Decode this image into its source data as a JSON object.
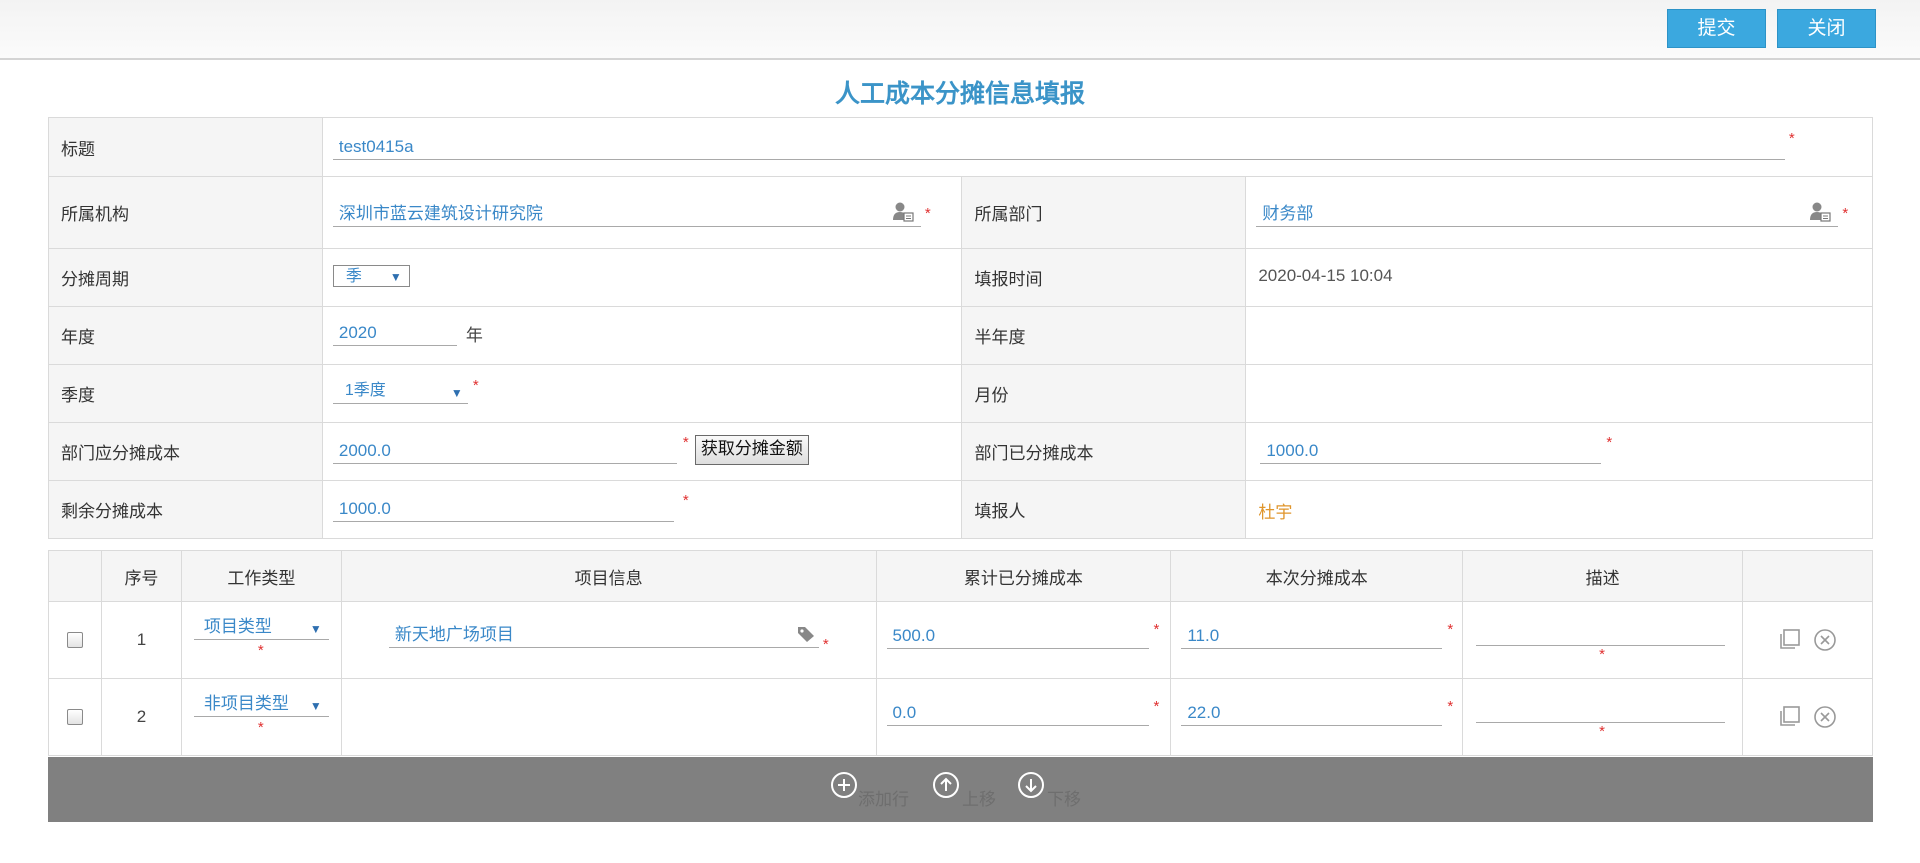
{
  "toolbar": {
    "submit_label": "提交",
    "close_label": "关闭"
  },
  "page_title": "人工成本分摊信息填报",
  "form": {
    "title": {
      "label": "标题",
      "value": "test0415a"
    },
    "org": {
      "label": "所属机构",
      "value": "深圳市蓝云建筑设计研究院"
    },
    "dept": {
      "label": "所属部门",
      "value": "财务部"
    },
    "period": {
      "label": "分摊周期",
      "value": "季"
    },
    "fill_time": {
      "label": "填报时间",
      "value": "2020-04-15 10:04"
    },
    "year": {
      "label": "年度",
      "value": "2020",
      "unit": "年"
    },
    "half_year": {
      "label": "半年度"
    },
    "quarter": {
      "label": "季度",
      "value": "1季度"
    },
    "month": {
      "label": "月份"
    },
    "dept_cost": {
      "label": "部门应分摊成本",
      "value": "2000.0",
      "button": "获取分摊金额"
    },
    "dept_allocated": {
      "label": "部门已分摊成本",
      "value": "1000.0"
    },
    "remaining": {
      "label": "剩余分摊成本",
      "value": "1000.0"
    },
    "reporter": {
      "label": "填报人",
      "value": "杜宇"
    }
  },
  "grid": {
    "headers": [
      "序号",
      "工作类型",
      "项目信息",
      "累计已分摊成本",
      "本次分摊成本",
      "描述"
    ],
    "rows": [
      {
        "no": "1",
        "type": "项目类型",
        "project": "新天地广场项目",
        "accum": "500.0",
        "current": "11.0",
        "desc": ""
      },
      {
        "no": "2",
        "type": "非项目类型",
        "project": "",
        "accum": "0.0",
        "current": "22.0",
        "desc": ""
      }
    ]
  },
  "footer": {
    "add_row": "添加行",
    "move_up": "上移",
    "move_down": "下移"
  },
  "colors": {
    "accent": "#3ba8df",
    "title": "#3b94c8",
    "value": "#3a88c8",
    "required": "#e03030",
    "reporter": "#e0962c"
  }
}
